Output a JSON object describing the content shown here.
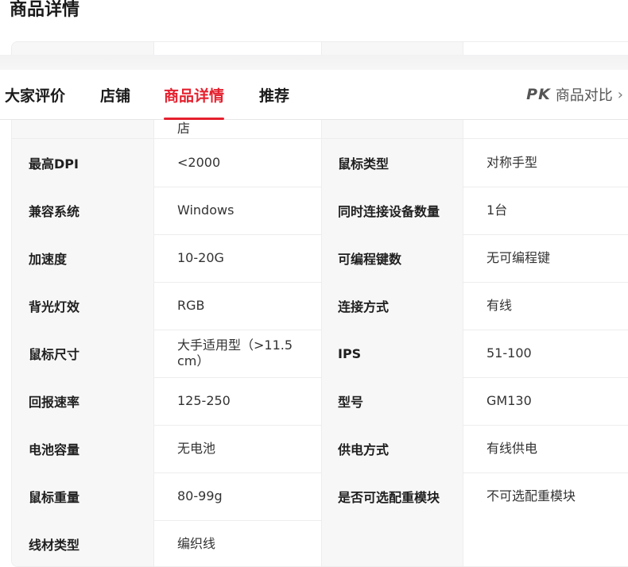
{
  "page": {
    "title": "商品详情"
  },
  "tabs": {
    "items": [
      {
        "label": "大家评价"
      },
      {
        "label": "店铺"
      },
      {
        "label": "商品详情",
        "active": true
      },
      {
        "label": "推荐"
      }
    ],
    "compare": {
      "icon_text": "PK",
      "label": "商品对比",
      "icon": "chevron-right-icon"
    },
    "accent_color": "#e5202e"
  },
  "partial_row": {
    "value": "店"
  },
  "specs": [
    {
      "label1": "最高DPI",
      "value1": "<2000",
      "label2": "鼠标类型",
      "value2": "对称手型"
    },
    {
      "label1": "兼容系统",
      "value1": "Windows",
      "label2": "同时连接设备数量",
      "value2": "1台"
    },
    {
      "label1": "加速度",
      "value1": "10-20G",
      "label2": "可编程键数",
      "value2": "无可编程键"
    },
    {
      "label1": "背光灯效",
      "value1": "RGB",
      "label2": "连接方式",
      "value2": "有线"
    },
    {
      "label1": "鼠标尺寸",
      "value1": "大手适用型（>11.5 cm）",
      "label2": "IPS",
      "value2": "51-100"
    },
    {
      "label1": "回报速率",
      "value1": "125-250",
      "label2": "型号",
      "value2": "GM130"
    },
    {
      "label1": "电池容量",
      "value1": "无电池",
      "label2": "供电方式",
      "value2": "有线供电"
    },
    {
      "label1": "鼠标重量",
      "value1": "80-99g",
      "label2": "是否可选配重模块",
      "value2": "不可选配重模块"
    },
    {
      "label1": "线材类型",
      "value1": "编织线",
      "label2": "",
      "value2": ""
    }
  ]
}
